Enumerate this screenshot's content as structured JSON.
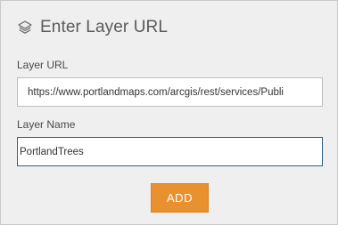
{
  "dialog": {
    "title": "Enter Layer URL",
    "icon": "layers-icon"
  },
  "form": {
    "layer_url_label": "Layer URL",
    "layer_url_value": "https://www.portlandmaps.com/arcgis/rest/services/Publi",
    "layer_name_label": "Layer Name",
    "layer_name_value": "PortlandTrees"
  },
  "actions": {
    "add_label": "ADD",
    "add_color": "#e8912e"
  }
}
